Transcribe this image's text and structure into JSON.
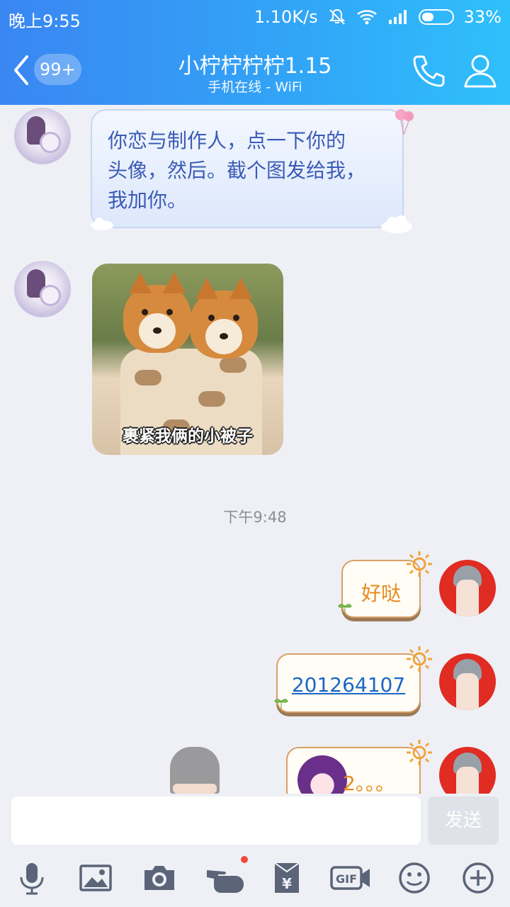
{
  "status_bar": {
    "time": "晚上9:55",
    "net_speed": "1.10K/s",
    "battery": "33%"
  },
  "header": {
    "unread_badge": "99+",
    "contact_name": "小柠柠柠柠1.15",
    "status": "手机在线 - WiFi"
  },
  "messages": [
    {
      "side": "left",
      "type": "text",
      "text_lines": [
        "你恋与制作人，点一下你的",
        "头像，然后。截个图发给我，",
        "我加你。"
      ]
    },
    {
      "side": "left",
      "type": "sticker",
      "caption": "裹紧我俩的小被子"
    },
    {
      "type": "timestamp",
      "text": "下午9:48"
    },
    {
      "side": "right",
      "type": "text",
      "text": "好哒"
    },
    {
      "side": "right",
      "type": "link",
      "text": "201264107"
    },
    {
      "side": "right",
      "type": "text",
      "text": "2。。。"
    }
  ],
  "input": {
    "send_label": "发送"
  },
  "toolbar": {
    "icons": [
      "microphone-icon",
      "image-icon",
      "camera-icon",
      "poke-icon",
      "red-packet-icon",
      "gif-icon",
      "emoji-icon",
      "plus-icon"
    ],
    "gif_label": "GIF",
    "red_packet_label": "¥"
  },
  "colors": {
    "header_gradient_start": "#3a86f2",
    "header_gradient_end": "#2fc0fb",
    "left_bubble_text": "#3b5bb6",
    "right_bubble_text": "#e68a1b",
    "link": "#1a67c7"
  }
}
